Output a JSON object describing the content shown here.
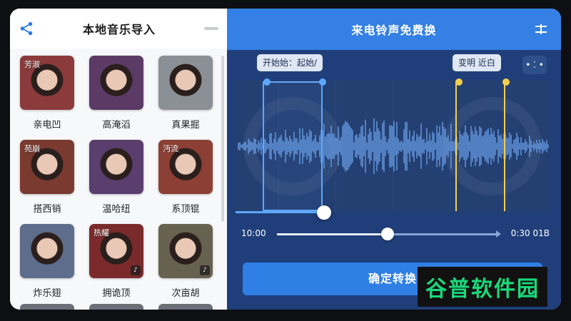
{
  "left_panel": {
    "title": "本地音乐导入",
    "cards": [
      {
        "tag": "芳淑",
        "label": "亲电凹",
        "hue": "#8b3b3c"
      },
      {
        "tag": "",
        "label": "高淹滔",
        "hue": "#5b3a66"
      },
      {
        "tag": "",
        "label": "真果掘",
        "hue": "#8b9096"
      },
      {
        "tag": "苑崩",
        "label": "搭西销",
        "hue": "#7a3a2f"
      },
      {
        "tag": "",
        "label": "温哈纽",
        "hue": "#5a3e6e"
      },
      {
        "tag": "沔流",
        "label": "系顶锟",
        "hue": "#8c3f34"
      },
      {
        "tag": "",
        "label": "炸乐翅",
        "hue": "#5f6d8c"
      },
      {
        "tag": "热耀",
        "label": "拥诡顶",
        "hue": "#7a2a2a"
      },
      {
        "tag": "",
        "label": "次亩胡",
        "hue": "#67614f"
      }
    ]
  },
  "right_panel": {
    "title": "来电铃声免费换",
    "start_pill": "开始始：起始/",
    "end_pill": "变明  近白",
    "time_start": "10:00",
    "time_end": "0:30 01B",
    "confirm_label": "确定转换"
  },
  "watermark": "谷普软件园",
  "colors": {
    "accent": "#2f7fe5",
    "selection": "#5ea7ff",
    "end_marker": "#f3cf4d",
    "wave": "#6ea6f0"
  }
}
